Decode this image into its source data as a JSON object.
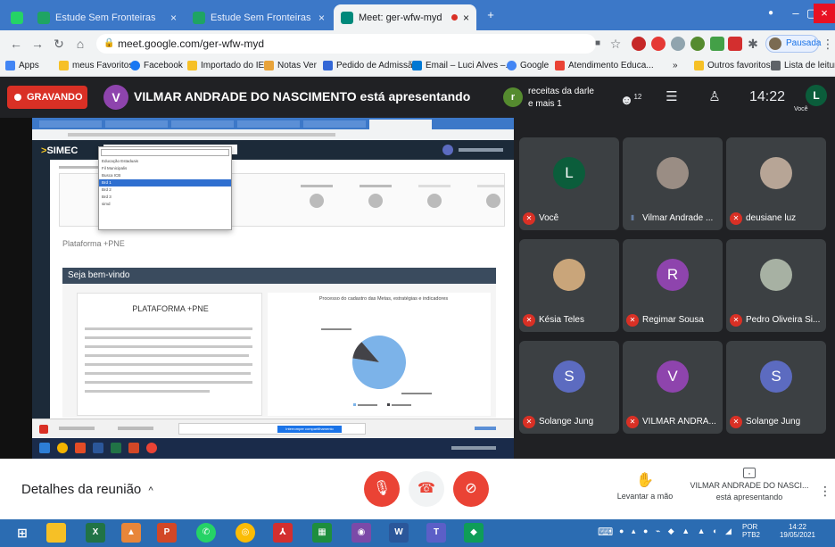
{
  "browser": {
    "tabs": [
      {
        "label": "Estude Sem Fronteiras",
        "close": "×"
      },
      {
        "label": "Estude Sem Fronteiras",
        "close": "×"
      },
      {
        "label": "Meet: ger-wfw-myd",
        "close": "×"
      }
    ],
    "new_tab": "+",
    "window_controls": {
      "minimize": "–",
      "maximize": "▢",
      "close": "×"
    },
    "url": "meet.google.com/ger-wfw-myd",
    "profile_label": "Pausada",
    "bookmarks": [
      {
        "label": "Apps",
        "color": "#5f6368"
      },
      {
        "label": "meus Favoritos",
        "color": "#f6c026"
      },
      {
        "label": "Facebook",
        "color": "#1877f2"
      },
      {
        "label": "Importado do IE",
        "color": "#f6c026"
      },
      {
        "label": "Notas Ver",
        "color": "#e8a33a"
      },
      {
        "label": "Pedido de Admissã...",
        "color": "#3367d6"
      },
      {
        "label": "Email – Luci Alves –...",
        "color": "#0078d4"
      },
      {
        "label": "Google",
        "color": "#4285f4"
      },
      {
        "label": "Atendimento Educa...",
        "color": "#ea4335"
      },
      {
        "label": "Outros favoritos",
        "color": "#f6c026"
      },
      {
        "label": "Lista de leitura",
        "color": "#5f6368"
      }
    ]
  },
  "meet": {
    "recording_label": "GRAVANDO",
    "presenter_initial": "V",
    "presenting_text": "VILMAR ANDRADE DO NASCIMENTO está apresentando",
    "chip_initial": "r",
    "chip_line1": "receitas da darle",
    "chip_line2": "e mais 1",
    "people_count": "12",
    "clock": "14:22",
    "self_initial": "L",
    "self_label": "Você",
    "participants": [
      {
        "name": "Você",
        "initial": "L",
        "color": "#0b5d3b",
        "photo": false,
        "mic_on": false
      },
      {
        "name": "Vilmar Andrade ...",
        "initial": "",
        "color": "#9a8d84",
        "photo": true,
        "mic_on": true
      },
      {
        "name": "deusiane luz",
        "initial": "",
        "color": "#b7a596",
        "photo": true,
        "mic_on": false
      },
      {
        "name": "Késia Teles",
        "initial": "",
        "color": "#c9a57a",
        "photo": true,
        "mic_on": false
      },
      {
        "name": "Regimar Sousa",
        "initial": "R",
        "color": "#8e44ad",
        "photo": false,
        "mic_on": false
      },
      {
        "name": "Pedro Oliveira Si...",
        "initial": "",
        "color": "#a7b1a3",
        "photo": true,
        "mic_on": false
      },
      {
        "name": "Solange Jung",
        "initial": "S",
        "color": "#5c6bc0",
        "photo": false,
        "mic_on": false
      },
      {
        "name": "VILMAR ANDRA...",
        "initial": "V",
        "color": "#8e44ad",
        "photo": false,
        "mic_on": false
      },
      {
        "name": "Solange Jung",
        "initial": "S",
        "color": "#5c6bc0",
        "photo": false,
        "mic_on": false
      }
    ],
    "details_label": "Detalhes da reunião",
    "details_chevron": "^",
    "raise_hand_label": "Levantar a mão",
    "presenter_name": "VILMAR ANDRADE DO NASCI...",
    "presenter_status": "está apresentando"
  },
  "shared_screen": {
    "logo_main": "SIMEC",
    "platform_label": "Plataforma +PNE",
    "welcome_label": "Seja bem-vindo",
    "card_title": "PLATAFORMA +PNE",
    "chart_title": "Processo do cadastro das Metas, estratégias e indicadores",
    "share_button": "Interromper compartilhamento",
    "dropdown_items": [
      "Educação Estaduais",
      "Fil Municipalis",
      "Busca ICB",
      "Brd 1",
      "Brd 2",
      "Brd 3",
      "simd"
    ],
    "dropdown_selected": 3
  },
  "chart_data": {
    "type": "pie",
    "values": [
      88.7,
      11.3
    ],
    "colors": [
      "#7cb3e9",
      "#434348"
    ]
  },
  "taskbar": {
    "lang": "POR",
    "lang2": "PTB2",
    "time": "14:22",
    "date": "19/05/2021"
  }
}
